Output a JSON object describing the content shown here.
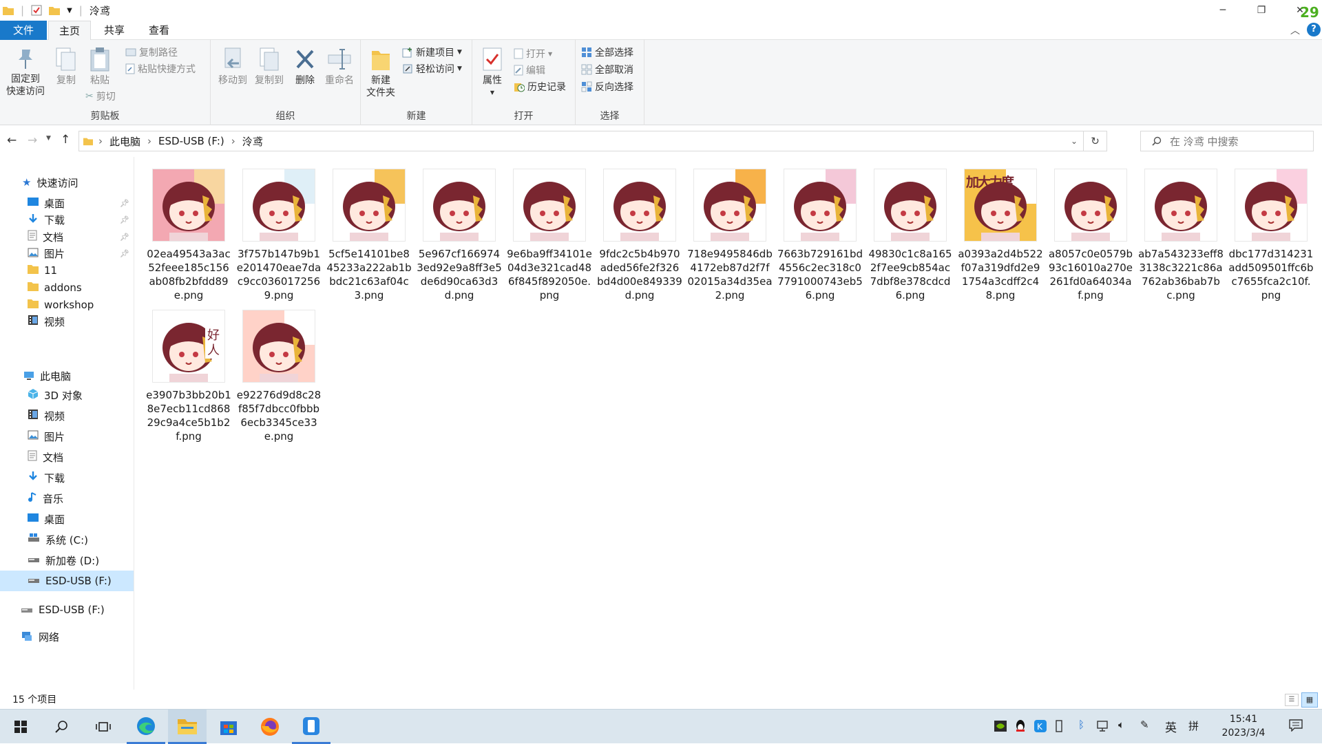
{
  "window": {
    "title": "泠鸢",
    "corner_badge": "29"
  },
  "menu_tabs": [
    "文件",
    "主页",
    "共享",
    "查看"
  ],
  "ribbon": {
    "clipboard": {
      "pin_label_1": "固定到",
      "pin_label_2": "快速访问",
      "copy": "复制",
      "paste": "粘贴",
      "copy_path": "复制路径",
      "paste_shortcut": "粘贴快捷方式",
      "cut": "剪切",
      "group": "剪贴板"
    },
    "organize": {
      "move_to": "移动到",
      "copy_to": "复制到",
      "delete": "删除",
      "rename": "重命名",
      "group": "组织"
    },
    "new": {
      "new_folder_1": "新建",
      "new_folder_2": "文件夹",
      "new_item": "新建项目",
      "easy_access": "轻松访问",
      "group": "新建"
    },
    "open": {
      "properties": "属性",
      "open": "打开",
      "edit": "编辑",
      "history": "历史记录",
      "group": "打开"
    },
    "select": {
      "select_all": "全部选择",
      "select_none": "全部取消",
      "invert": "反向选择",
      "group": "选择"
    }
  },
  "address": {
    "crumbs": [
      "此电脑",
      "ESD-USB (F:)",
      "泠鸢"
    ],
    "search_placeholder": "在 泠鸢 中搜索"
  },
  "nav": {
    "quick_access": "快速访问",
    "quick_items": [
      "桌面",
      "下载",
      "文档",
      "图片",
      "11",
      "addons",
      "workshop",
      "视频"
    ],
    "this_pc": "此电脑",
    "pc_items": [
      "3D 对象",
      "视频",
      "图片",
      "文档",
      "下载",
      "音乐",
      "桌面",
      "系统 (C:)",
      "新加卷 (D:)",
      "ESD-USB (F:)"
    ],
    "usb": "ESD-USB (F:)",
    "network": "网络"
  },
  "files": [
    {
      "name": "02ea49543a3ac52feee185c156ab08fb2bfdd89e.png",
      "bubble": ""
    },
    {
      "name": "3f757b147b9b1e201470eae7dac9cc0360172569.png",
      "bubble": ""
    },
    {
      "name": "5cf5e14101be845233a222ab1bbdc21c63af04c3.png",
      "bubble": ""
    },
    {
      "name": "5e967cf1669743ed92e9a8ff3e5de6d90ca63d3d.png",
      "bubble": ""
    },
    {
      "name": "9e6ba9ff34101e04d3e321cad486f845f892050e.png",
      "bubble": ""
    },
    {
      "name": "9fdc2c5b4b970aded56fe2f326bd4d00e849339d.png",
      "bubble": ""
    },
    {
      "name": "718e9495846db4172eb87d2f7f02015a34d35ea2.png",
      "bubble": ""
    },
    {
      "name": "7663b729161bd4556c2ec318c07791000743eb56.png",
      "bubble": ""
    },
    {
      "name": "49830c1c8a1652f7ee9cb854ac7dbf8e378cdcd6.png",
      "bubble": ""
    },
    {
      "name": "a0393a2d4b522f07a319dfd2e91754a3cdff2c48.png",
      "bubble": "加大力度"
    },
    {
      "name": "a8057c0e0579b93c16010a270e261fd0a64034af.png",
      "bubble": ""
    },
    {
      "name": "ab7a543233eff83138c3221c86a762ab36bab7bc.png",
      "bubble": ""
    },
    {
      "name": "dbc177d314231add509501ffc6bc7655fca2c10f.png",
      "bubble": ""
    },
    {
      "name": "e3907b3bb20b18e7ecb11cd86829c9a4ce5b1b2f.png",
      "bubble": "好人"
    },
    {
      "name": "e92276d9d8c28f85f7dbcc0fbbb6ecb3345ce33e.png",
      "bubble": ""
    }
  ],
  "status": {
    "count": "15 个项目"
  },
  "taskbar": {
    "ime_lang": "英",
    "ime_mode": "拼",
    "time": "15:41",
    "date": "2023/3/4"
  },
  "colors": {
    "accent": "#1979ca",
    "hair": "#7a2630",
    "selected_nav": "#cce8ff"
  }
}
